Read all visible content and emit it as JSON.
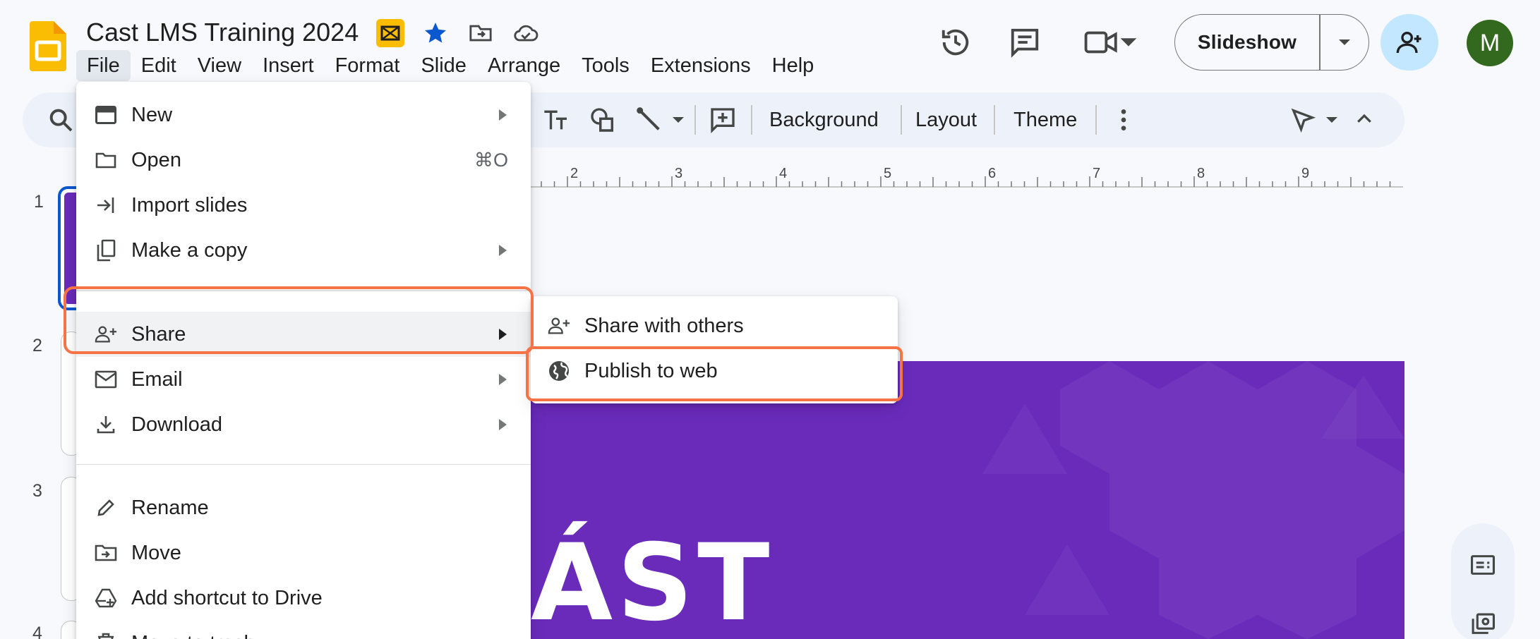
{
  "app": {
    "doc_title": "Cast LMS Training 2024",
    "colors": {
      "accent": "#0b57d0",
      "highlight": "#f57345",
      "slide_bg": "#6a2bbb",
      "avatar": "#33691e",
      "share_button": "#c2e7ff"
    }
  },
  "menubar": {
    "items": [
      "File",
      "Edit",
      "View",
      "Insert",
      "Format",
      "Slide",
      "Arrange",
      "Tools",
      "Extensions",
      "Help"
    ]
  },
  "header": {
    "slideshow_label": "Slideshow",
    "avatar_initial": "M",
    "icons": [
      "version-history-icon",
      "comments-icon",
      "meet-icon",
      "add-person-icon"
    ]
  },
  "toolbar": {
    "background_label": "Background",
    "layout_label": "Layout",
    "theme_label": "Theme"
  },
  "ruler": {
    "ticks": [
      "2",
      "3",
      "4",
      "5",
      "6",
      "7",
      "8",
      "9"
    ]
  },
  "filmstrip": {
    "slide_numbers": [
      "1",
      "2",
      "3",
      "4"
    ]
  },
  "slide": {
    "logo_text": "ÁST"
  },
  "file_menu": {
    "new": "New",
    "open": "Open",
    "open_shortcut": "⌘O",
    "import": "Import slides",
    "copy": "Make a copy",
    "share": "Share",
    "email": "Email",
    "download": "Download",
    "rename": "Rename",
    "move": "Move",
    "shortcut": "Add shortcut to Drive",
    "trash": "Move to trash"
  },
  "share_submenu": {
    "share_with_others": "Share with others",
    "publish_to_web": "Publish to web"
  }
}
